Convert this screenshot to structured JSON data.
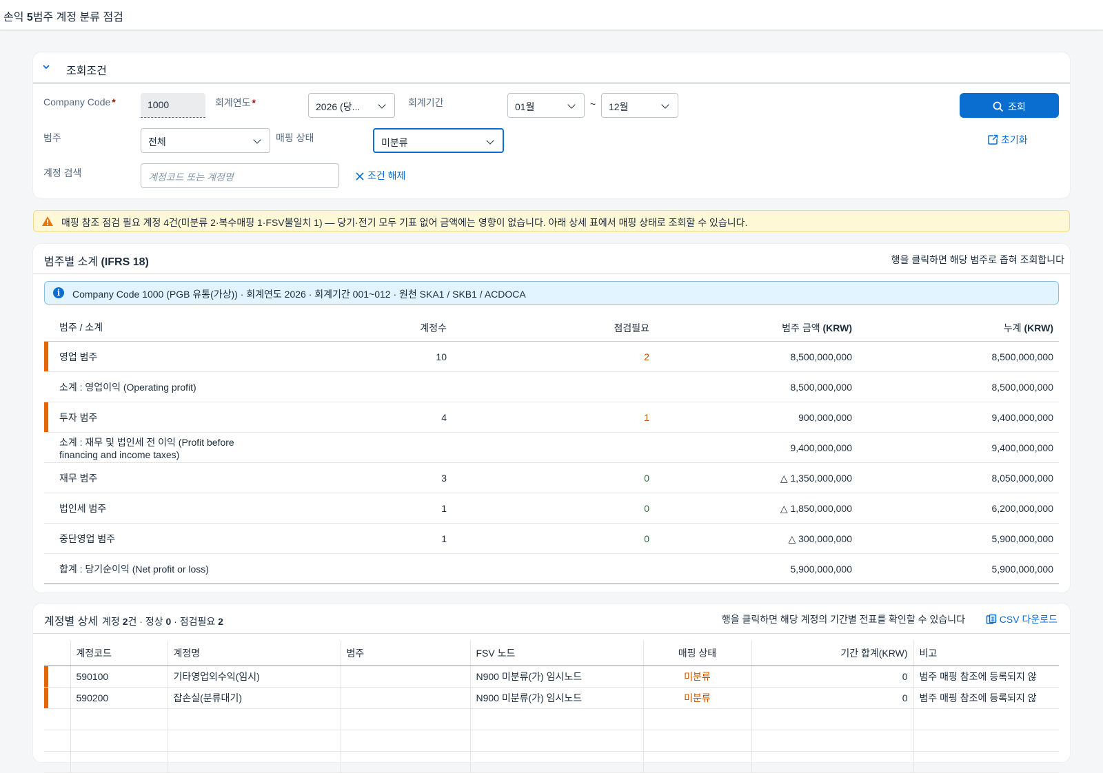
{
  "page": {
    "title_prefix": "손익 ",
    "title_bold": "5",
    "title_suffix": "범주 계정 분류 점검"
  },
  "filter": {
    "title": "조회조건",
    "company_code_label": "Company Code",
    "company_code_value": "1000",
    "fiscal_year_label": "회계연도",
    "fiscal_year_value": "2026 (당...",
    "period_label": "회계기간",
    "period_from": "01월",
    "period_sep": "~",
    "period_to": "12월",
    "category_label": "범주",
    "category_value": "전체",
    "mapping_label": "매핑 상태",
    "mapping_value": "미분류",
    "account_search_label": "계정 검색",
    "account_search_placeholder": "계정코드 또는 계정명",
    "clear_label": "조건 해제",
    "search_button": "조회",
    "reset_button": "초기화",
    "required_mark": "*"
  },
  "warning": {
    "text": "매핑 참조 점검 필요 계정 4건(미분류 2·복수매핑 1·FSV불일치 1) — 당기·전기 모두 기표 없어 금액에는 영향이 없습니다. 아래 상세 표에서 매핑 상태로 조회할 수 있습니다.",
    "icon": "warning-triangle-icon",
    "color": "#e9730c"
  },
  "summary": {
    "title_prefix": "범주별 소계 ",
    "title_bold": "(IFRS 18)",
    "hint": "행을 클릭하면 해당 범주로 좁혀 조회합니다",
    "info": "Company Code 1000 (PGB 유통(가상)) · 회계연도 2026 · 회계기간 001~012 · 원천 SKA1 / SKB1 / ACDOCA",
    "columns": [
      "범주 / 소계",
      "계정수",
      "점검필요",
      "범주 금액 (KRW)",
      "누계 (KRW)"
    ],
    "rows": [
      {
        "label": "영업 범주",
        "accounts": "10",
        "check": "2",
        "amount": "8,500,000,000",
        "cumulative": "8,500,000,000",
        "flag": true,
        "check_status": "warn"
      },
      {
        "label": "소계 : 영업이익 (Operating profit)",
        "accounts": "",
        "check": "",
        "amount": "8,500,000,000",
        "cumulative": "8,500,000,000",
        "flag": false,
        "check_status": ""
      },
      {
        "label": "투자 범주",
        "accounts": "4",
        "check": "1",
        "amount": "900,000,000",
        "cumulative": "9,400,000,000",
        "flag": true,
        "check_status": "warn"
      },
      {
        "label": "소계 : 재무 및 법인세 전 이익 (Profit before financing and income taxes)",
        "accounts": "",
        "check": "",
        "amount": "9,400,000,000",
        "cumulative": "9,400,000,000",
        "flag": false,
        "check_status": "",
        "two_line": true
      },
      {
        "label": "재무 범주",
        "accounts": "3",
        "check": "0",
        "amount": "△ 1,350,000,000",
        "cumulative": "8,050,000,000",
        "flag": false,
        "check_status": "ok"
      },
      {
        "label": "법인세 범주",
        "accounts": "1",
        "check": "0",
        "amount": "△ 1,850,000,000",
        "cumulative": "6,200,000,000",
        "flag": false,
        "check_status": "ok"
      },
      {
        "label": "중단영업 범주",
        "accounts": "1",
        "check": "0",
        "amount": "△ 300,000,000",
        "cumulative": "5,900,000,000",
        "flag": false,
        "check_status": "ok"
      },
      {
        "label": "합계 : 당기순이익 (Net profit or loss)",
        "accounts": "",
        "check": "",
        "amount": "5,900,000,000",
        "cumulative": "5,900,000,000",
        "flag": false,
        "check_status": ""
      }
    ]
  },
  "details": {
    "title": "계정별 상세",
    "count_text_1": "계정 ",
    "count_total": "2",
    "count_text_2": "건 · 정상 ",
    "count_normal": "0",
    "count_text_3": " · 점검필요 ",
    "count_check": "2",
    "hint": "행을 클릭하면 해당 계정의 기간별 전표를 확인할 수 있습니다",
    "csv_label": "CSV 다운로드",
    "columns": [
      "계정코드",
      "계정명",
      "범주",
      "FSV 노드",
      "매핑 상태",
      "기간 합계(KRW)",
      "비고"
    ],
    "rows": [
      {
        "code": "590100",
        "name": "기타영업외수익(임시)",
        "category": "",
        "fsv": "N900 미분류(가) 임시노드",
        "status": "미분류",
        "total": "0",
        "note": "범주 매핑 참조에 등록되지 않"
      },
      {
        "code": "590200",
        "name": "잡손실(분류대기)",
        "category": "",
        "fsv": "N900 미분류(가) 임시노드",
        "status": "미분류",
        "total": "0",
        "note": "범주 매핑 참조에 등록되지 않"
      }
    ]
  },
  "colors": {
    "accent": "#0a6ed1",
    "warning_bar": "#e76500",
    "warning_text": "#c35500",
    "ok_text": "#256f3a",
    "required": "#aa0808"
  }
}
